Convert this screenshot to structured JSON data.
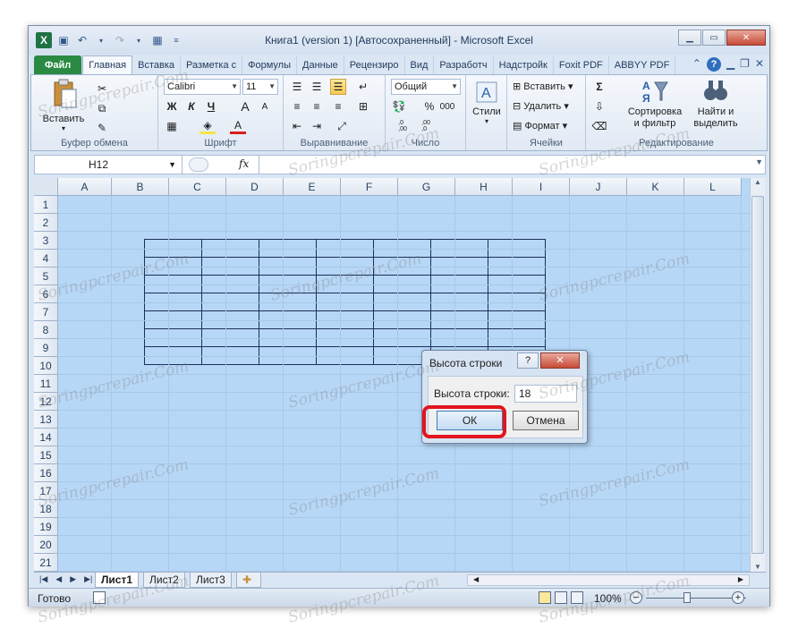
{
  "window": {
    "title": "Книга1 (version 1) [Автосохраненный]  -  Microsoft Excel",
    "app_icon_letter": "X"
  },
  "tabs": [
    "Файл",
    "Главная",
    "Вставка",
    "Разметка с",
    "Формулы",
    "Данные",
    "Рецензиро",
    "Вид",
    "Разработч",
    "Надстройк",
    "Foxit PDF",
    "ABBYY PDF"
  ],
  "ribbon": {
    "clipboard": {
      "paste": "Вставить",
      "label": "Буфер обмена"
    },
    "font": {
      "name": "Calibri",
      "size": "11",
      "bold": "Ж",
      "italic": "К",
      "underline": "Ч",
      "grow": "A",
      "shrink": "A",
      "color": "A",
      "label": "Шрифт"
    },
    "alignment": {
      "label": "Выравнивание"
    },
    "number": {
      "format": "Общий",
      "percent": "%",
      "thousands": "000",
      "inc_decimal": ",0\n,00",
      "dec_decimal": ",00\n,0",
      "label": "Число"
    },
    "styles": {
      "label": "Стили"
    },
    "cells": {
      "insert": "Вставить",
      "delete": "Удалить",
      "format": "Формат",
      "label": "Ячейки"
    },
    "editing": {
      "sigma": "Σ",
      "sort": "Сортировка\nи фильтр",
      "find": "Найти и\nвыделить",
      "label": "Редактирование"
    }
  },
  "formula_bar": {
    "name_box": "H12",
    "fx": "fx",
    "value": ""
  },
  "grid": {
    "columns": [
      "A",
      "B",
      "C",
      "D",
      "E",
      "F",
      "G",
      "H",
      "I",
      "J",
      "K",
      "L"
    ],
    "rows": [
      "1",
      "2",
      "3",
      "4",
      "5",
      "6",
      "7",
      "8",
      "9",
      "10",
      "11",
      "12",
      "13",
      "14",
      "15",
      "16",
      "17",
      "18",
      "19",
      "20",
      "21"
    ]
  },
  "sheets": [
    "Лист1",
    "Лист2",
    "Лист3"
  ],
  "status": {
    "ready": "Готово",
    "zoom": "100%"
  },
  "dialog": {
    "title": "Высота строки",
    "help": "?",
    "close": "✕",
    "field_label": "Высота строки:",
    "field_value": "18",
    "ok": "ОК",
    "cancel": "Отмена"
  },
  "watermark": "Soringpcrepair.Com",
  "colors": {
    "grid_bg": "#b7d7f6",
    "file_tab": "#2a8a43",
    "highlight": "#e3141c"
  }
}
